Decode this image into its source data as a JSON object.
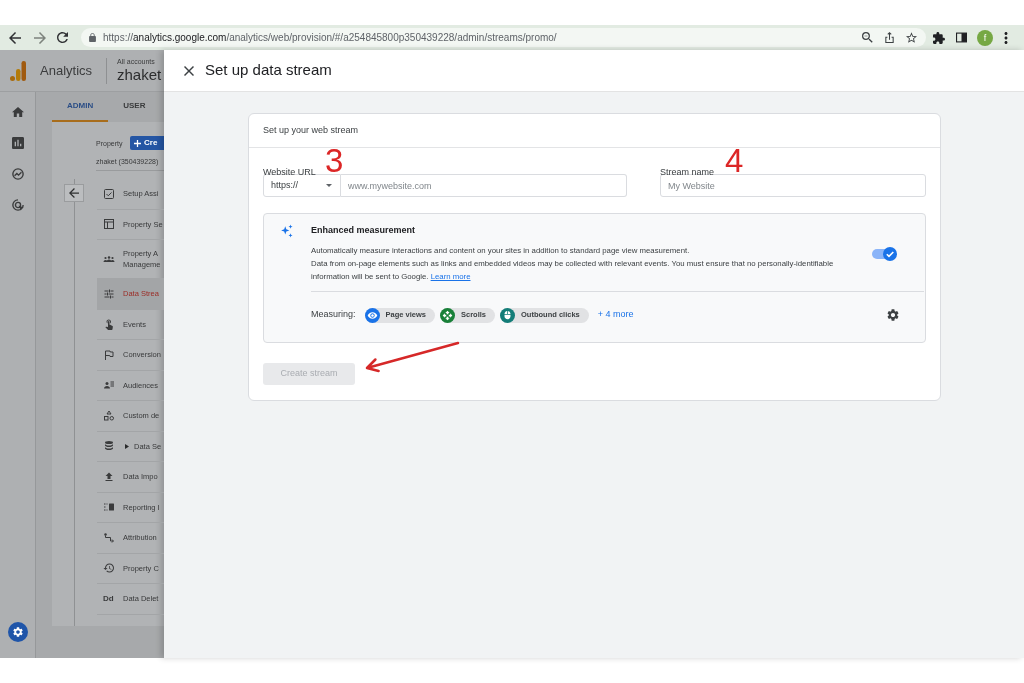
{
  "browser": {
    "url_scheme": "https://",
    "url_host": "analytics.google.com",
    "url_path": "/analytics/web/provision/#/a254845800p350439228/admin/streams/promo/",
    "profile_initial": "f"
  },
  "app_header": {
    "product": "Analytics",
    "breadcrumb": "All accounts",
    "account": "zhaket"
  },
  "admin_tabs": [
    {
      "label": "ADMIN",
      "selected": true
    },
    {
      "label": "USER",
      "selected": false
    }
  ],
  "property": {
    "label": "Property",
    "create_button": "Cre",
    "name": "zhaket (350439228)"
  },
  "admin_menu": [
    {
      "kind": "page",
      "label": "Setup Assi",
      "selected": false
    },
    {
      "kind": "page",
      "label": "Property Se",
      "selected": false
    },
    {
      "kind": "page",
      "label": "Property A\nManageme",
      "selected": false
    },
    {
      "kind": "page",
      "label": "Data Strea",
      "selected": true
    },
    {
      "kind": "page",
      "label": "Events",
      "selected": false
    },
    {
      "kind": "page",
      "label": "Conversion",
      "selected": false
    },
    {
      "kind": "page",
      "label": "Audiences",
      "selected": false
    },
    {
      "kind": "page",
      "label": "Custom de",
      "selected": false
    },
    {
      "kind": "group",
      "label": "Data Se",
      "selected": false,
      "expanded": false
    },
    {
      "kind": "page",
      "label": "Data Impo",
      "selected": false
    },
    {
      "kind": "page",
      "label": "Reporting I",
      "selected": false
    },
    {
      "kind": "page",
      "label": "Attribution",
      "selected": false
    },
    {
      "kind": "page",
      "label": "Property C",
      "selected": false
    },
    {
      "kind": "page",
      "label": "Data Delet",
      "icon_text": "Dd",
      "selected": false
    }
  ],
  "dialog": {
    "title": "Set up data stream"
  },
  "stream_card": {
    "heading": "Set up your web stream",
    "fields": [
      {
        "kind": "url",
        "label": "Website URL",
        "annotation": "3",
        "protocol": "https://",
        "placeholder": "www.mywebsite.com"
      },
      {
        "kind": "text",
        "label": "Stream name",
        "annotation": "4",
        "placeholder": "My Website"
      }
    ],
    "enhanced_measurement": {
      "title": "Enhanced measurement",
      "description": [
        "Automatically measure interactions and content on your sites in addition to standard page view measurement.",
        "Data from on-page elements such as links and embedded videos may be collected with relevant events. You must ensure that no personally-identifiable information will be sent to Google."
      ],
      "link": "Learn more",
      "on": true,
      "measuring_label": "Measuring:",
      "chips": [
        {
          "label": "Page views",
          "color": "#1a73e8"
        },
        {
          "label": "Scrolls",
          "color": "#188038"
        },
        {
          "label": "Outbound clicks",
          "color": "#137d78"
        }
      ],
      "more_link": "+ 4 more"
    },
    "create_button": {
      "label": "Create stream",
      "disabled": true
    }
  }
}
